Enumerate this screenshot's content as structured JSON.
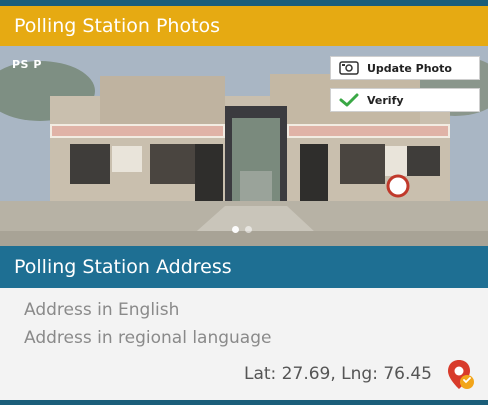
{
  "photos": {
    "title": "Polling Station Photos",
    "badge": "PS P",
    "update_label": "Update Photo",
    "verify_label": "Verify",
    "slides_total": 2,
    "slide_active": 1
  },
  "address": {
    "title": "Polling Station Address",
    "english": "Address in English",
    "regional": "Address in regional language",
    "coords": "Lat: 27.69, Lng: 76.45"
  },
  "icons": {
    "update": "photo-icon",
    "verify": "checkmark-icon",
    "location": "map-pin-icon"
  },
  "colors": {
    "header_photos": "#e6aa12",
    "header_address": "#1e6f93",
    "verify_check": "#3aa845",
    "pin_red": "#d83b2b",
    "pin_orange": "#f2a51a"
  }
}
